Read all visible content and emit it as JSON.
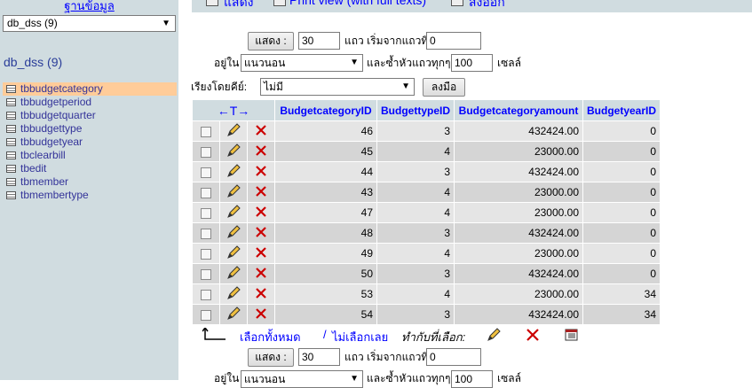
{
  "sidebar": {
    "heading": "ฐานข้อมูล",
    "db_select": "db_dss (9)",
    "db_name": "db_dss (9)",
    "tables": [
      {
        "label": "tbbudgetcategory",
        "active": true
      },
      {
        "label": "tbbudgetperiod",
        "active": false
      },
      {
        "label": "tbbudgetquarter",
        "active": false
      },
      {
        "label": "tbbudgettype",
        "active": false
      },
      {
        "label": "tbbudgetyear",
        "active": false
      },
      {
        "label": "tbclearbill",
        "active": false
      },
      {
        "label": "tbedit",
        "active": false
      },
      {
        "label": "tbmember",
        "active": false
      },
      {
        "label": "tbmembertype",
        "active": false
      }
    ]
  },
  "topbar": {
    "item1": "แสดง",
    "item2": "Print view (with full texts)",
    "item3": "ส่งออก"
  },
  "nav_top": {
    "show_button": "แสดง :",
    "rows_value": "30",
    "rows_start_label": "แถว เริ่มจากแถวที่",
    "start_value": "0",
    "mode_label": "อยู่ใน",
    "mode_value": "แนวนอน",
    "repeat_label": "และซ้ำหัวแถวทุกๆ",
    "repeat_value": "100",
    "cells_label": "เซลล์"
  },
  "sort": {
    "label": "เรียงโดยคีย์:",
    "value": "ไม่มี",
    "go_button": "ลงมือ"
  },
  "table": {
    "columns": [
      "BudgetcategoryID",
      "BudgettypeID",
      "Budgetcategoryamount",
      "BudgetyearID"
    ],
    "rows": [
      [
        "46",
        "3",
        "432424.00",
        "0"
      ],
      [
        "45",
        "4",
        "23000.00",
        "0"
      ],
      [
        "44",
        "3",
        "432424.00",
        "0"
      ],
      [
        "43",
        "4",
        "23000.00",
        "0"
      ],
      [
        "47",
        "4",
        "23000.00",
        "0"
      ],
      [
        "48",
        "3",
        "432424.00",
        "0"
      ],
      [
        "49",
        "4",
        "23000.00",
        "0"
      ],
      [
        "50",
        "3",
        "432424.00",
        "0"
      ],
      [
        "53",
        "4",
        "23000.00",
        "34"
      ],
      [
        "54",
        "3",
        "432424.00",
        "34"
      ]
    ]
  },
  "bottom": {
    "select_all": "เลือกทั้งหมด",
    "separator": "/",
    "deselect_all": "ไม่เลือกเลย",
    "with_selected": "ทำกับที่เลือก:"
  },
  "nav_bottom": {
    "show_button": "แสดง :",
    "rows_value": "30",
    "rows_start_label": "แถว เริ่มจากแถวที่",
    "start_value": "0",
    "mode_label": "อยู่ใน",
    "mode_value": "แนวนอน",
    "repeat_label": "และซ้ำหัวแถวทุกๆ",
    "repeat_value": "100",
    "cells_label": "เซลล์"
  },
  "colors": {
    "sidebar_bg": "#d0dce0",
    "active_row": "#ffcc99",
    "link": "#0000ff",
    "row_odd": "#e5e5e5",
    "row_even": "#d5d5d5",
    "delete": "#cc0000"
  }
}
